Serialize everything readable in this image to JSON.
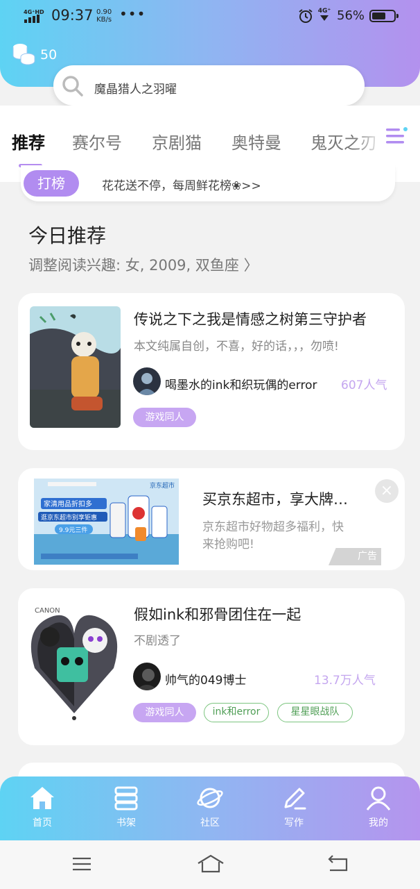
{
  "status_bar": {
    "network_label": "4G⁺HD",
    "time": "09:37",
    "speed_value": "0.90",
    "speed_unit": "KB/s",
    "overflow": "•••",
    "battery_percent": "56%",
    "network_right": "4G⁺"
  },
  "header": {
    "coin_count": "50",
    "search_placeholder": "魔晶猎人之羽曜"
  },
  "tabs": [
    {
      "label": "推荐",
      "active": true
    },
    {
      "label": "赛尔号",
      "active": false
    },
    {
      "label": "京剧猫",
      "active": false
    },
    {
      "label": "奥特曼",
      "active": false
    },
    {
      "label": "鬼灭之刃",
      "active": false
    }
  ],
  "rank_bar": {
    "badge": "打榜",
    "text": "花花送不停，每周鲜花榜❀>>"
  },
  "section": {
    "title": "今日推荐",
    "subtitle": "调整阅读兴趣: 女, 2009, 双鱼座 〉"
  },
  "books": [
    {
      "title": "传说之下之我是情感之树第三守护者",
      "desc": "本文纯属自创，不喜，好的话，，，勿喷!",
      "author": "喝墨水的ink和织玩偶的error",
      "popularity": "607人气",
      "tags": [
        "游戏同人"
      ]
    },
    {
      "title": "假如ink和邪骨团住在一起",
      "desc": "不剧透了",
      "author": "帅气的049博士",
      "popularity": "13.7万人气",
      "tags": [
        "游戏同人",
        "ink和error",
        "星星眼战队"
      ]
    }
  ],
  "ad": {
    "title": "买京东超市，享大牌…",
    "desc": "京东超市好物超多福利，快来抢购吧!",
    "badge": "广告",
    "close": "×",
    "image_text_1": "京东超市",
    "image_text_2": "家清用品折扣多",
    "image_text_3": "逛京东超市别享钜惠",
    "image_text_4": "9.9元三件"
  },
  "bottom_nav": [
    {
      "label": "首页",
      "icon": "home-icon"
    },
    {
      "label": "书架",
      "icon": "bookshelf-icon"
    },
    {
      "label": "社区",
      "icon": "planet-icon"
    },
    {
      "label": "写作",
      "icon": "pencil-icon"
    },
    {
      "label": "我的",
      "icon": "profile-icon"
    }
  ],
  "colors": {
    "accent_purple": "#b18cf0",
    "gradient_start": "#5ed3f3",
    "gradient_end": "#b391ee",
    "popularity": "#c4a6ef",
    "tag_outline": "#7cc57f"
  }
}
